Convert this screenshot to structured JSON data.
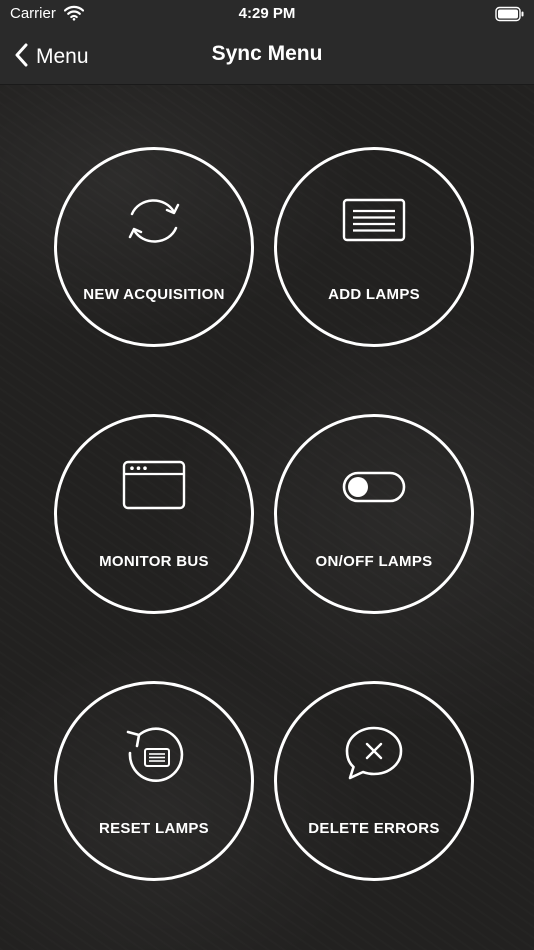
{
  "status_bar": {
    "carrier": "Carrier",
    "time": "4:29 PM"
  },
  "nav": {
    "back_label": "Menu",
    "title": "Sync Menu"
  },
  "menu": {
    "new_acquisition": {
      "label": "NEW ACQUISITION",
      "icon": "sync-icon"
    },
    "add_lamps": {
      "label": "ADD LAMPS",
      "icon": "list-icon"
    },
    "monitor_bus": {
      "label": "MONITOR BUS",
      "icon": "window-icon"
    },
    "on_off_lamps": {
      "label": "ON/OFF LAMPS",
      "icon": "toggle-icon"
    },
    "reset_lamps": {
      "label": "RESET LAMPS",
      "icon": "reset-icon"
    },
    "delete_errors": {
      "label": "DELETE ERRORS",
      "icon": "chat-delete-icon"
    }
  },
  "colors": {
    "background": "#222120",
    "bar": "#2a2a2a",
    "foreground": "#ffffff"
  }
}
